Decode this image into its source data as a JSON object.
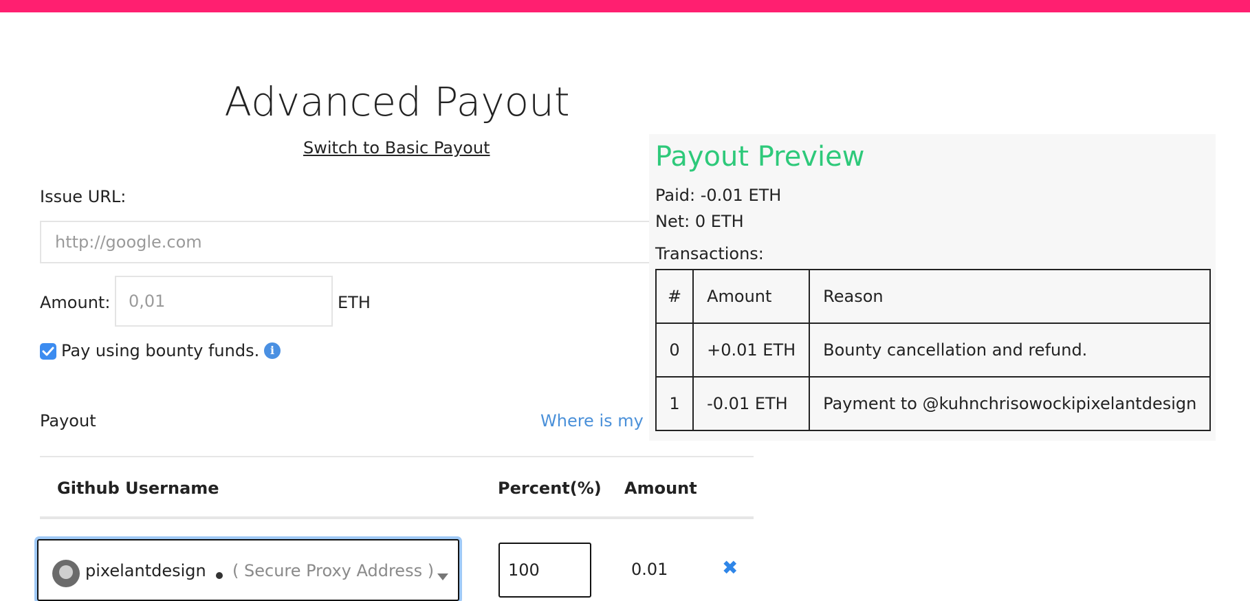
{
  "colors": {
    "top_bar": "#ff1f70",
    "preview_title": "#2ec97a",
    "link": "#4a90d9",
    "checkbox": "#3c8cf0",
    "remove_icon": "#2f86e8"
  },
  "page": {
    "title": "Advanced Payout",
    "switch_link": "Switch to Basic Payout"
  },
  "form": {
    "issue_label": "Issue URL:",
    "issue_placeholder": "http://google.com",
    "amount_label": "Amount:",
    "amount_placeholder": "0,01",
    "amount_unit": "ETH",
    "checkbox_label": "Pay using bounty funds.",
    "checkbox_checked": true,
    "info_icon": "info-icon"
  },
  "payout": {
    "title": "Payout",
    "where_link": "Where is my I",
    "columns": {
      "username": "Github Username",
      "percent": "Percent(%)",
      "amount": "Amount"
    },
    "rows": [
      {
        "username": "pixelantdesign",
        "proxy": "( Secure Proxy Address )",
        "percent": "100",
        "amount": "0.01",
        "remove_icon": "close-icon"
      }
    ]
  },
  "preview": {
    "title": "Payout Preview",
    "paid": "Paid: -0.01 ETH",
    "net": "Net: 0 ETH",
    "transactions_label": "Transactions:",
    "columns": [
      "#",
      "Amount",
      "Reason"
    ],
    "transactions": [
      {
        "idx": "0",
        "amount": "+0.01 ETH",
        "reason": "Bounty cancellation and refund."
      },
      {
        "idx": "1",
        "amount": "-0.01 ETH",
        "reason": "Payment to @kuhnchrisowockipixelantdesign"
      }
    ]
  }
}
